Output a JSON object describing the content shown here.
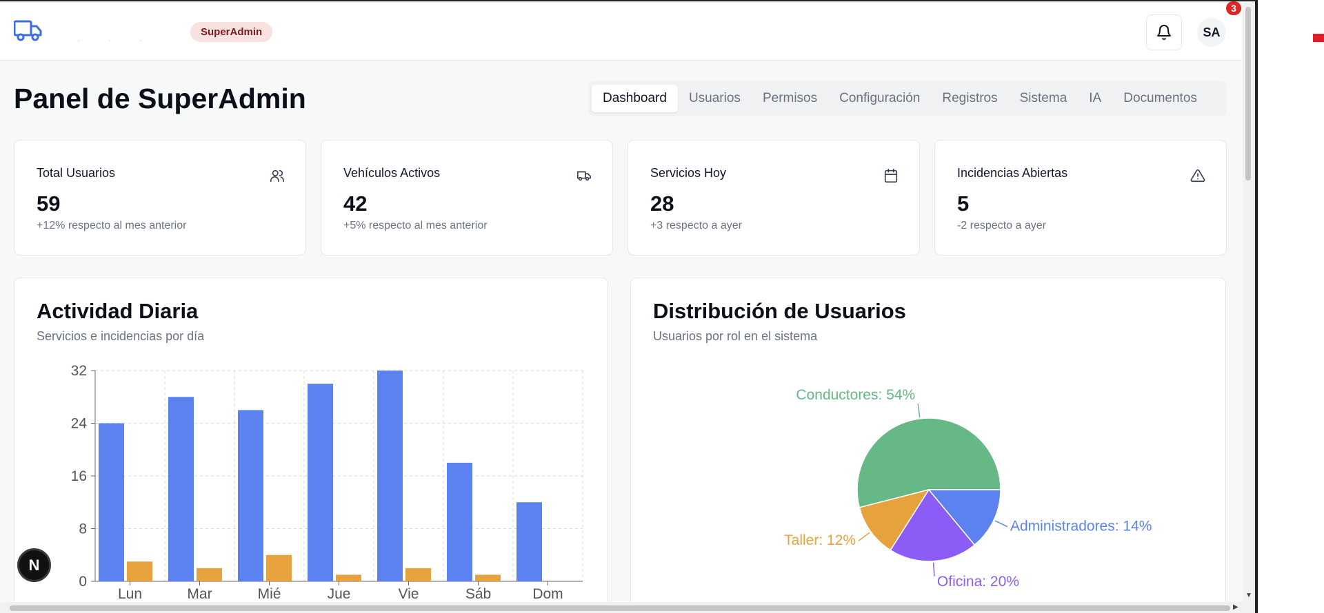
{
  "header": {
    "role_badge": "SuperAdmin",
    "avatar_initials": "SA",
    "notification_count": "3"
  },
  "page": {
    "title": "Panel de SuperAdmin"
  },
  "tabs": [
    {
      "label": "Dashboard",
      "active": true
    },
    {
      "label": "Usuarios",
      "active": false
    },
    {
      "label": "Permisos",
      "active": false
    },
    {
      "label": "Configuración",
      "active": false
    },
    {
      "label": "Registros",
      "active": false
    },
    {
      "label": "Sistema",
      "active": false
    },
    {
      "label": "IA",
      "active": false
    },
    {
      "label": "Documentos",
      "active": false
    }
  ],
  "stats": [
    {
      "label": "Total Usuarios",
      "value": "59",
      "delta": "+12% respecto al mes anterior",
      "icon": "users-icon"
    },
    {
      "label": "Vehículos Activos",
      "value": "42",
      "delta": "+5% respecto al mes anterior",
      "icon": "truck-icon"
    },
    {
      "label": "Servicios Hoy",
      "value": "28",
      "delta": "+3 respecto a ayer",
      "icon": "calendar-icon"
    },
    {
      "label": "Incidencias Abiertas",
      "value": "5",
      "delta": "-2 respecto a ayer",
      "icon": "alert-triangle-icon"
    }
  ],
  "activity": {
    "title": "Actividad Diaria",
    "subtitle": "Servicios e incidencias por día"
  },
  "distribution": {
    "title": "Distribución de Usuarios",
    "subtitle": "Usuarios por rol en el sistema"
  },
  "colors": {
    "blue": "#5b82ef",
    "orange": "#e6a23c",
    "green": "#66b886",
    "purple": "#8b5cf6",
    "badge_bg": "#f8e1e1",
    "badge_text": "#7f1d1d",
    "notif_red": "#dc2626"
  },
  "chart_data": [
    {
      "type": "bar",
      "categories": [
        "Lun",
        "Mar",
        "Mié",
        "Jue",
        "Vie",
        "Sáb",
        "Dom"
      ],
      "series": [
        {
          "values": [
            24,
            28,
            26,
            30,
            32,
            18,
            12
          ],
          "color": "#5b82ef"
        },
        {
          "values": [
            3,
            2,
            4,
            1,
            2,
            1,
            0
          ],
          "color": "#e6a23c"
        }
      ],
      "yticks": [
        0,
        8,
        16,
        24,
        32
      ],
      "ylim": [
        0,
        32
      ],
      "grid": true
    },
    {
      "type": "pie",
      "slices": [
        {
          "label": "Conductores: 54%",
          "value": 54,
          "color": "#66b886"
        },
        {
          "label": "Taller: 12%",
          "value": 12,
          "color": "#e6a23c"
        },
        {
          "label": "Oficina: 20%",
          "value": 20,
          "color": "#8b5cf6"
        },
        {
          "label": "Administradores: 14%",
          "value": 14,
          "color": "#5b82ef"
        }
      ]
    }
  ]
}
